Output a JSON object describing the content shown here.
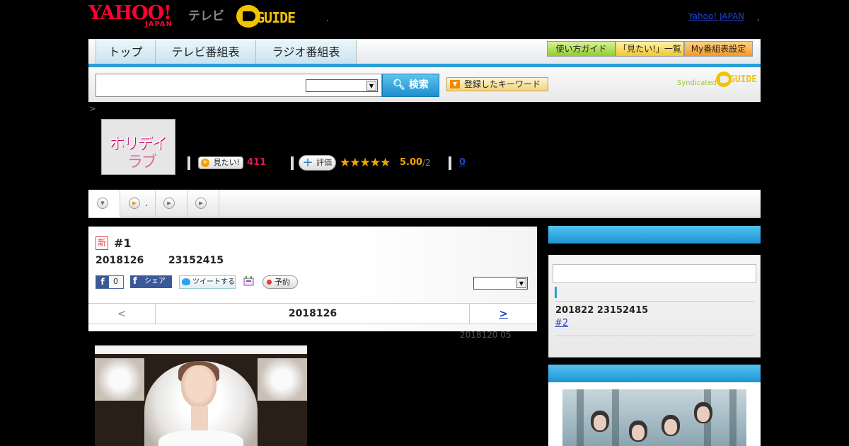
{
  "header": {
    "yahoo_logo": "YAHOO!",
    "yahoo_logo_sub": "JAPAN",
    "tv_label": "テレビ",
    "gguide_logo": "GUIDE",
    "yahoo_japan_link": "Yahoo! JAPAN"
  },
  "nav": {
    "tabs": [
      {
        "label": "トップ"
      },
      {
        "label": "テレビ番組表"
      },
      {
        "label": "ラジオ番組表"
      }
    ],
    "guide_buttons": [
      {
        "label": "使い方ガイド"
      },
      {
        "label": "「見たい!」一覧"
      },
      {
        "label": "My番組表設定"
      }
    ]
  },
  "search": {
    "input_value": "",
    "select_value": "",
    "button_label": "検索",
    "keyword_button_label": "登録したキーワード",
    "syndicated_label": "Syndicated",
    "syndicated_logo": "GUIDE"
  },
  "breadcrumb": ">",
  "program": {
    "thumbnail_title_1": "ホリデイ",
    "thumbnail_title_2": "ラブ",
    "mitai_label": "見たい!",
    "mitai_count": "411",
    "hyoka_label": "評価",
    "stars": "★★★★★",
    "score": "5.00",
    "score_count": "/2",
    "review_count": "0"
  },
  "subtabs": {
    "items": [
      {
        "label": ""
      },
      {
        "label": "."
      },
      {
        "label": ""
      },
      {
        "label": ""
      }
    ]
  },
  "episode": {
    "new_badge": "新",
    "title": "#1",
    "date": "2018126",
    "time": "23152415",
    "fb_like_count": "0",
    "fb_share_label": "シェア",
    "tweet_label": "ツイートする",
    "reserve_label": "予約",
    "select_value": "",
    "nav_prev": "<",
    "nav_current": "2018126",
    "nav_next": ">",
    "updated": "2018120  05"
  },
  "sidebar": {
    "episode_date": "201822  23152415",
    "episode_link": "#2"
  },
  "colors": {
    "accent_blue": "#2b9fd9",
    "pink_count": "#e6155a",
    "star_orange": "#f2a600",
    "link_blue": "#2244cc"
  }
}
